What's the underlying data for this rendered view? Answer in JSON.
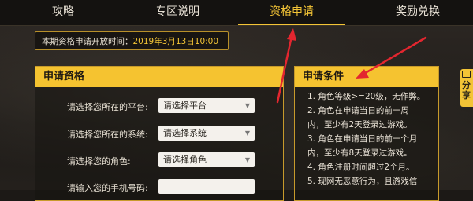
{
  "tabs": [
    {
      "label": "攻略"
    },
    {
      "label": "专区说明"
    },
    {
      "label": "资格申请"
    },
    {
      "label": "奖励兑换"
    }
  ],
  "notice": {
    "prefix": "本期资格申请开放时间：",
    "date": "2019年3月13日10:00"
  },
  "apply_panel": {
    "title": "申请资格",
    "rows": [
      {
        "label": "请选择您所在的平台:",
        "value": "请选择平台"
      },
      {
        "label": "请选择您所在的系统:",
        "value": "请选择系统"
      },
      {
        "label": "请选择您的角色:",
        "value": "请选择角色"
      },
      {
        "label": "请输入您的手机号码:",
        "value": ""
      }
    ]
  },
  "conditions_panel": {
    "title": "申请条件",
    "lines": [
      "1. 角色等级>=20级，无作弊。",
      "2. 角色在申请当日的前一周",
      "内，至少有2天登录过游戏。",
      "3. 角色在申请当日的前一个月",
      "内，至少有8天登录过游戏。",
      "4. 角色注册时间超过2个月。",
      "5. 现网无恶意行为，且游戏信"
    ]
  },
  "share": {
    "label": "分享"
  },
  "colors": {
    "accent": "#f3c436",
    "arrow": "#e3262f"
  }
}
